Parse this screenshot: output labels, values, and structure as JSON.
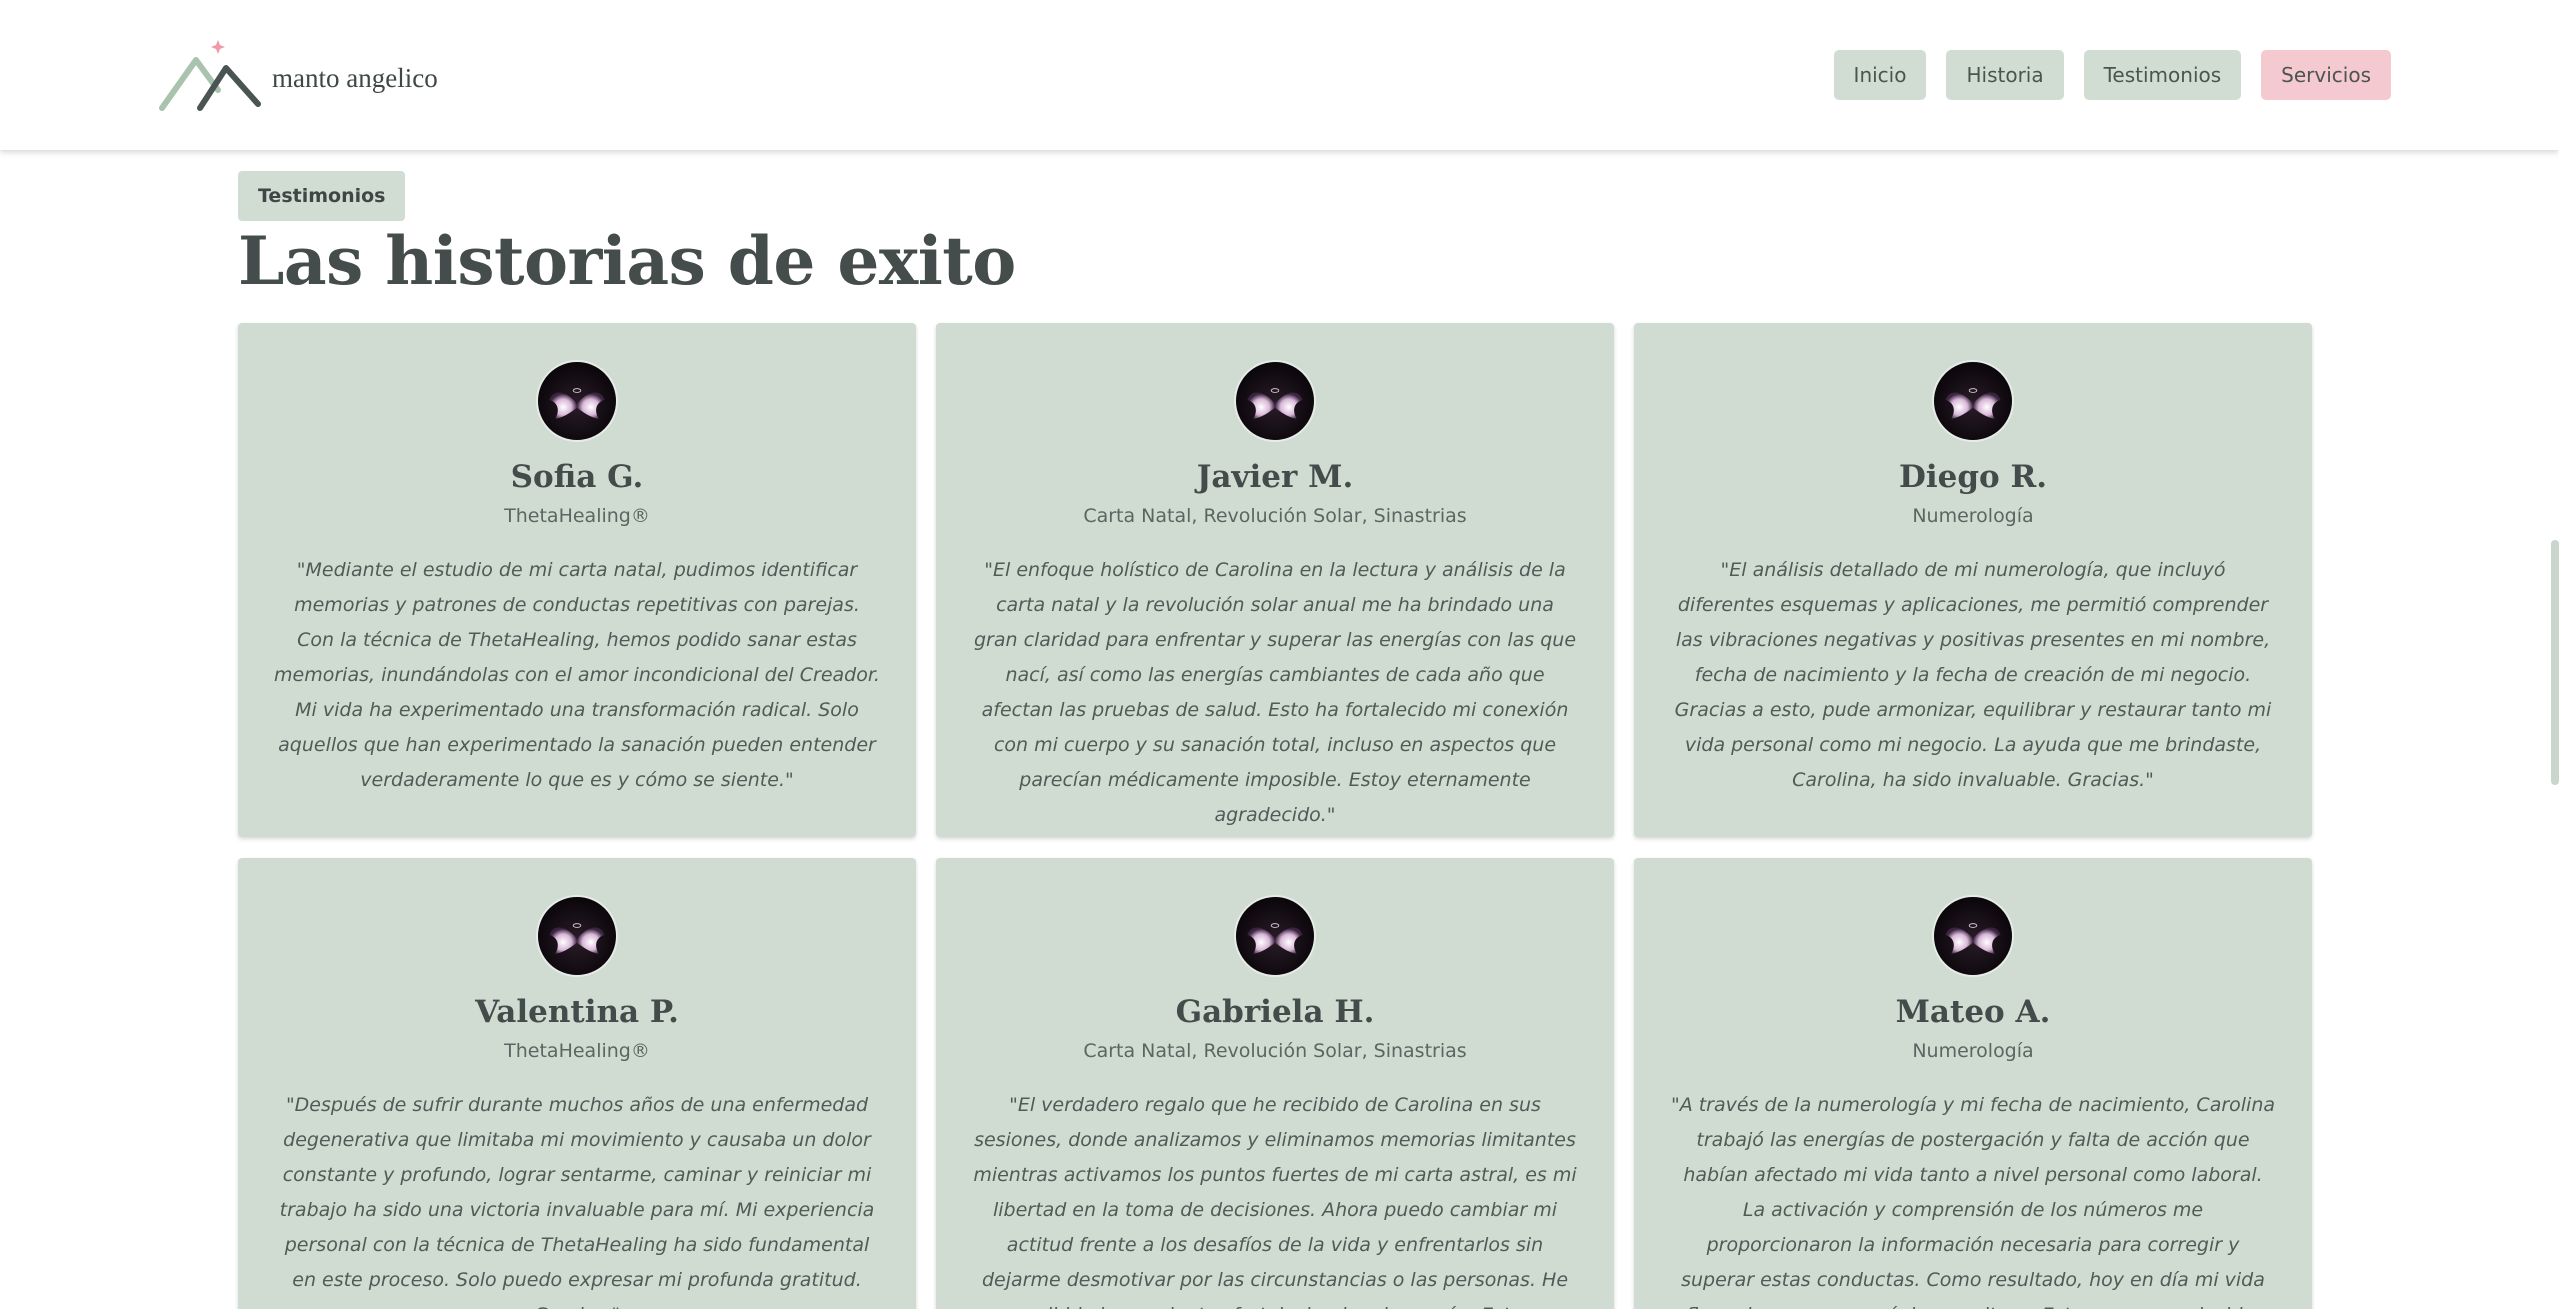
{
  "header": {
    "brand": "manto angelico",
    "nav": [
      "Inicio",
      "Historia",
      "Testimonios",
      "Servicios"
    ]
  },
  "section": {
    "tag": "Testimonios",
    "title": "Las historias de exito"
  },
  "testimonials": [
    {
      "name": "Sofia G.",
      "service": "ThetaHealing®",
      "quote": "\"Mediante el estudio de mi carta natal, pudimos identificar memorias y patrones de conductas repetitivas con parejas. Con la técnica de ThetaHealing, hemos podido sanar estas memorias, inundándolas con el amor incondicional del Creador. Mi vida ha experimentado una transformación radical. Solo aquellos que han experimentado la sanación pueden entender verdaderamente lo que es y cómo se siente.\""
    },
    {
      "name": "Javier M.",
      "service": "Carta Natal, Revolución Solar, Sinastrias",
      "quote": "\"El enfoque holístico de Carolina en la lectura y análisis de la carta natal y la revolución solar anual me ha brindado una gran claridad para enfrentar y superar las energías con las que nací, así como las energías cambiantes de cada año que afectan las pruebas de salud. Esto ha fortalecido mi conexión con mi cuerpo y su sanación total, incluso en aspectos que parecían médicamente imposible. Estoy eternamente agradecido.\""
    },
    {
      "name": "Diego R.",
      "service": "Numerología",
      "quote": "\"El análisis detallado de mi numerología, que incluyó diferentes esquemas y aplicaciones, me permitió comprender las vibraciones negativas y positivas presentes en mi nombre, fecha de nacimiento y la fecha de creación de mi negocio. Gracias a esto, pude armonizar, equilibrar y restaurar tanto mi vida personal como mi negocio. La ayuda que me brindaste, Carolina, ha sido invaluable. Gracias.\""
    },
    {
      "name": "Valentina P.",
      "service": "ThetaHealing®",
      "quote": "\"Después de sufrir durante muchos años de una enfermedad degenerativa que limitaba mi movimiento y causaba un dolor constante y profundo, lograr sentarme, caminar y reiniciar mi trabajo ha sido una victoria invaluable para mí. Mi experiencia personal con la técnica de ThetaHealing ha sido fundamental en este proceso. Solo puedo expresar mi profunda gratitud. Gracias.\""
    },
    {
      "name": "Gabriela H.",
      "service": "Carta Natal, Revolución Solar, Sinastrias",
      "quote": "\"El verdadero regalo que he recibido de Carolina en sus sesiones, donde analizamos y eliminamos memorias limitantes mientras activamos los puntos fuertes de mi carta astral, es mi libertad en la toma de decisiones. Ahora puedo cambiar mi actitud frente a los desafíos de la vida y enfrentarlos sin dejarme desmotivar por las circunstancias o las personas. He recibido herramientas fortaleciendo mi corazón. Estoy eternamente agradecida.\""
    },
    {
      "name": "Mateo A.",
      "service": "Numerología",
      "quote": "\"A través de la numerología y mi fecha de nacimiento, Carolina trabajó las energías de postergación y falta de acción que habían afectado mi vida tanto a nivel personal como laboral. La activación y comprensión de los números me proporcionaron la información necesaria para corregir y superar estas conductas. Como resultado, hoy en día mi vida fluye de manera armónica y exitosa. Estoy muy agradecido, Carolina.\""
    }
  ]
}
